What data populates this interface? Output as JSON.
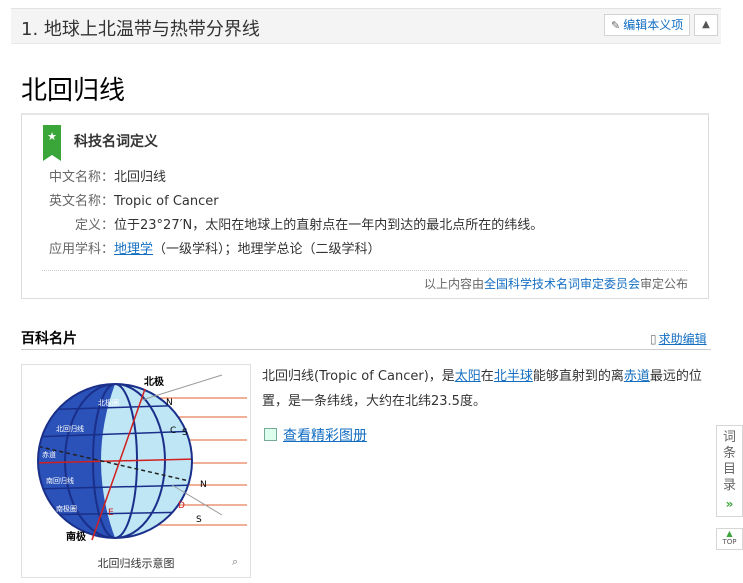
{
  "section": {
    "title": "1. 地球上北温带与热带分界线",
    "edit_label": "编辑本义项",
    "collapse_icon": "chevron-up-icon"
  },
  "lemma": {
    "title": "北回归线"
  },
  "definition": {
    "heading": "科技名词定义",
    "rows": [
      {
        "label": "中文名称：",
        "value": "北回归线"
      },
      {
        "label": "英文名称：",
        "value": "Tropic of Cancer"
      },
      {
        "label": "定义：",
        "value": "位于23°27′N，太阳在地球上的直射点在一年内到达的最北点所在的纬线。"
      }
    ],
    "discipline": {
      "label": "应用学科：",
      "link": "地理学",
      "level1": "（一级学科）；",
      "rest": "地理学总论（二级学科）"
    },
    "source": {
      "prefix": "以上内容由",
      "link": "全国科学技术名词审定委员会",
      "suffix": "审定公布"
    }
  },
  "card": {
    "heading": "百科名片",
    "help_edit": "求助编辑",
    "image_caption": "北回归线示意图",
    "diagram_labels": {
      "north_pole": "北极",
      "south_pole": "南极",
      "n1": "N",
      "s1": "S",
      "n2": "N",
      "s2": "S",
      "c": "C",
      "d": "D",
      "e": "E",
      "band1": "北极圈",
      "band2": "北回归线",
      "band3": "赤道",
      "band4": "南回归线",
      "band5": "南极圈"
    },
    "summary": {
      "p1": "北回归线(Tropic of Cancer)，是",
      "link1": "太阳",
      "p2": "在",
      "link2": "北半球",
      "p3": "能够直射到的离",
      "link3": "赤道",
      "p4": "最远的位置，是一条纬线，大约在北纬23.5度。"
    },
    "album_link": "查看精彩图册"
  },
  "side": {
    "toc_label": [
      "词",
      "条",
      "目",
      "录"
    ],
    "toc_arrow": "»",
    "top_label": "TOP"
  }
}
